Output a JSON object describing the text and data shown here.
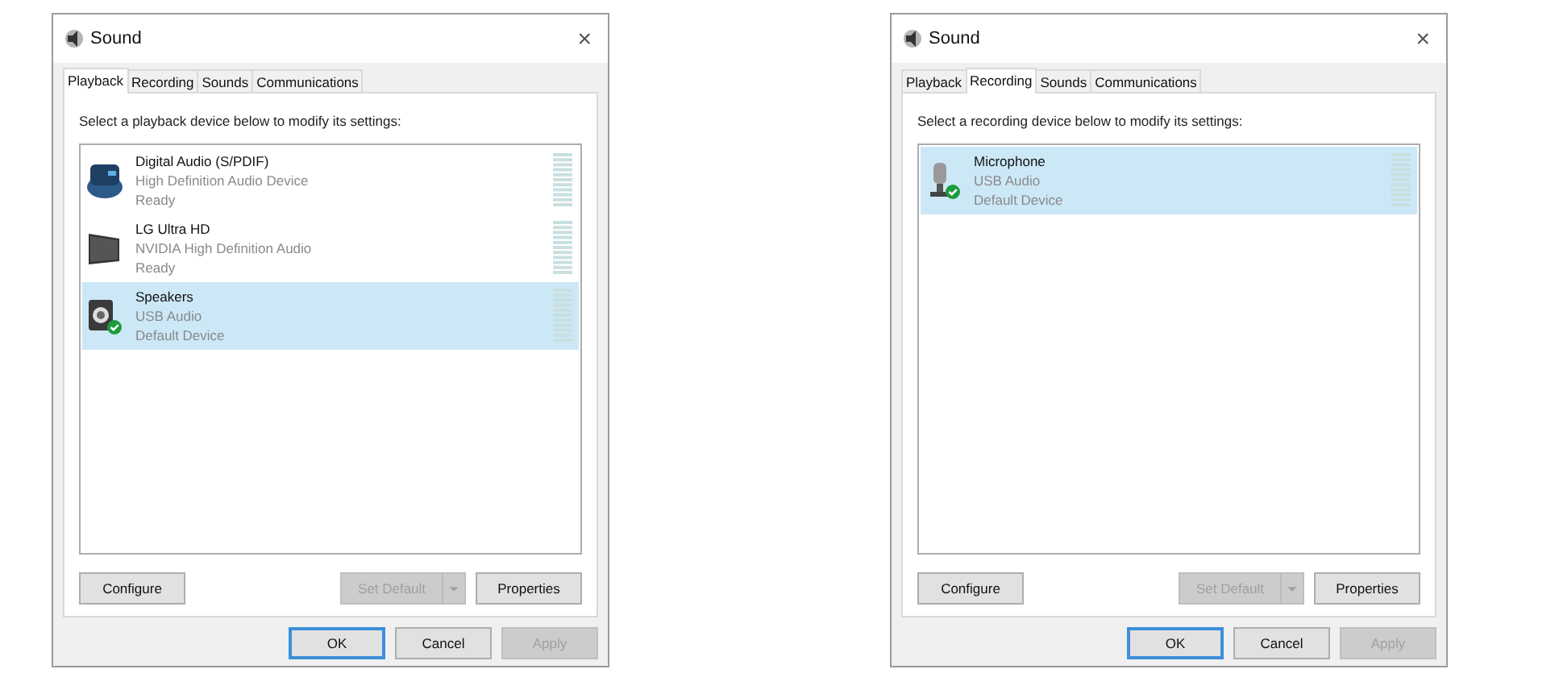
{
  "dialogs": [
    {
      "title": "Sound",
      "close": "×",
      "tabs": [
        {
          "label": "Playback",
          "selected": true
        },
        {
          "label": "Recording",
          "selected": false
        },
        {
          "label": "Sounds",
          "selected": false
        },
        {
          "label": "Communications",
          "selected": false
        }
      ],
      "instruction": "Select a playback device below to modify its settings:",
      "devices": [
        {
          "kind": "spdif",
          "name": "Digital Audio (S/PDIF)",
          "driver": "High Definition Audio Device",
          "status": "Ready",
          "selected": false,
          "default": false
        },
        {
          "kind": "monitor",
          "name": "LG Ultra HD",
          "driver": "NVIDIA High Definition Audio",
          "status": "Ready",
          "selected": false,
          "default": false
        },
        {
          "kind": "speaker",
          "name": "Speakers",
          "driver": "USB Audio",
          "status": "Default Device",
          "selected": true,
          "default": true
        }
      ],
      "panel_buttons": [
        {
          "kind": "button",
          "label": "Configure",
          "disabled": false
        },
        {
          "kind": "split",
          "label": "Set Default",
          "disabled": true
        },
        {
          "kind": "button",
          "label": "Properties",
          "disabled": false
        }
      ],
      "footer_buttons": [
        {
          "label": "OK",
          "disabled": false,
          "focused": true
        },
        {
          "label": "Cancel",
          "disabled": false,
          "focused": false
        },
        {
          "label": "Apply",
          "disabled": true,
          "focused": false
        }
      ]
    },
    {
      "title": "Sound",
      "close": "×",
      "tabs": [
        {
          "label": "Playback",
          "selected": false
        },
        {
          "label": "Recording",
          "selected": true
        },
        {
          "label": "Sounds",
          "selected": false
        },
        {
          "label": "Communications",
          "selected": false
        }
      ],
      "instruction": "Select a recording device below to modify its settings:",
      "devices": [
        {
          "kind": "microphone",
          "name": "Microphone",
          "driver": "USB Audio",
          "status": "Default Device",
          "selected": true,
          "default": true
        }
      ],
      "panel_buttons": [
        {
          "kind": "button",
          "label": "Configure",
          "disabled": false
        },
        {
          "kind": "split",
          "label": "Set Default",
          "disabled": true
        },
        {
          "kind": "button",
          "label": "Properties",
          "disabled": false
        }
      ],
      "footer_buttons": [
        {
          "label": "OK",
          "disabled": false,
          "focused": true
        },
        {
          "label": "Cancel",
          "disabled": false,
          "focused": false
        },
        {
          "label": "Apply",
          "disabled": true,
          "focused": false
        }
      ]
    }
  ]
}
